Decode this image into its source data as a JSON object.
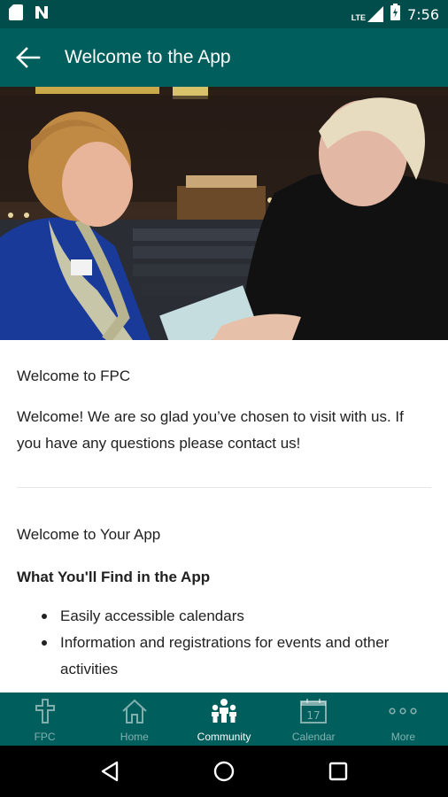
{
  "status_bar": {
    "time": "7:56",
    "network": "LTE"
  },
  "app_bar": {
    "title": "Welcome to the App"
  },
  "content": {
    "welcome_title": "Welcome to FPC",
    "welcome_text": "Welcome! We are so glad you’ve chosen to visit with us. If you have any questions please contact us!",
    "app_title": "Welcome to Your App",
    "find_title": "What You'll Find in the App",
    "bullets": [
      "Easily accessible calendars",
      "Information and registrations for events and other activities"
    ]
  },
  "tabs": [
    {
      "label": "FPC",
      "icon": "cross-icon",
      "active": false
    },
    {
      "label": "Home",
      "icon": "home-icon",
      "active": false
    },
    {
      "label": "Community",
      "icon": "community-icon",
      "active": true
    },
    {
      "label": "Calendar",
      "icon": "calendar-icon",
      "active": false,
      "calendar_day": "17"
    },
    {
      "label": "More",
      "icon": "more-icon",
      "active": false
    }
  ],
  "colors": {
    "app_bar": "#005f5d",
    "status_bar": "#004d4b",
    "nav_bar": "#000000"
  }
}
